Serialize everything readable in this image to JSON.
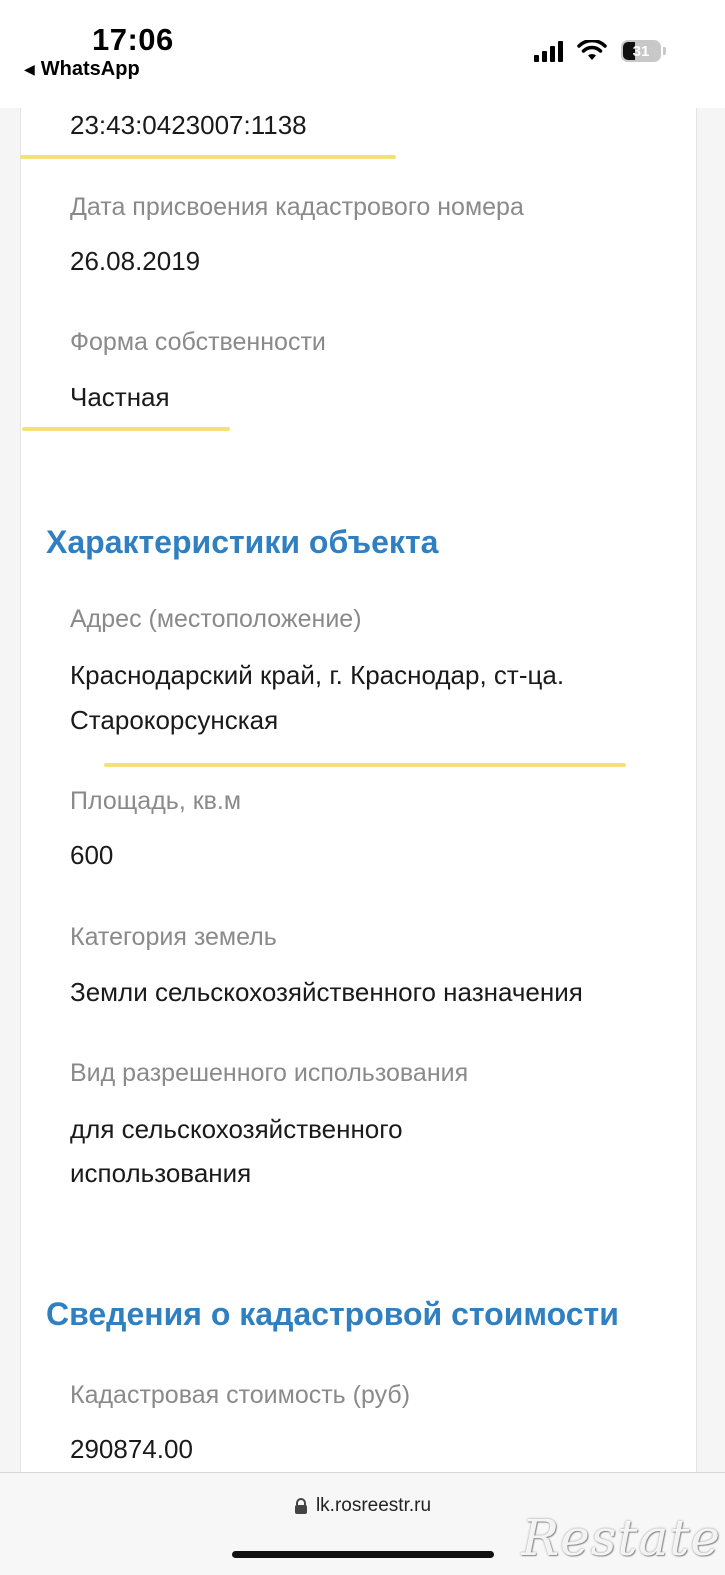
{
  "status_bar": {
    "time": "17:06",
    "back_app": "WhatsApp",
    "battery": "31",
    "back_icon": "triangle-left-icon",
    "signal_icon": "cellular-signal-icon",
    "wifi_icon": "wifi-icon"
  },
  "fields_top": {
    "cadastral_number_value": "23:43:0423007:1138",
    "assign_date_label": "Дата присвоения кадастрового номера",
    "assign_date_value": "26.08.2019",
    "ownership_label": "Форма собственности",
    "ownership_value": "Частная"
  },
  "characteristics": {
    "title": "Характеристики объекта",
    "address_label": "Адрес (местоположение)",
    "address_line1": "Краснодарский край, г. Краснодар, ст-ца.",
    "address_line2": "Старокорсунская",
    "area_label": "Площадь, кв.м",
    "area_value": "600",
    "land_category_label": "Категория земель",
    "land_category_value": "Земли сельскохозяйственного назначения",
    "permitted_use_label": "Вид разрешенного использования",
    "permitted_use_line1": "для сельскохозяйственного",
    "permitted_use_line2": "использования"
  },
  "cadastral_value": {
    "title": "Сведения о кадастровой стоимости",
    "value_label": "Кадастровая стоимость (руб)",
    "value": "290874.00"
  },
  "browser": {
    "url": "lk.rosreestr.ru",
    "lock_icon": "lock-icon"
  },
  "watermark": {
    "text": "Restate"
  },
  "colors": {
    "section_title": "#2f7fc1",
    "highlight": "#f3e27a",
    "label": "#8a8a8a"
  }
}
